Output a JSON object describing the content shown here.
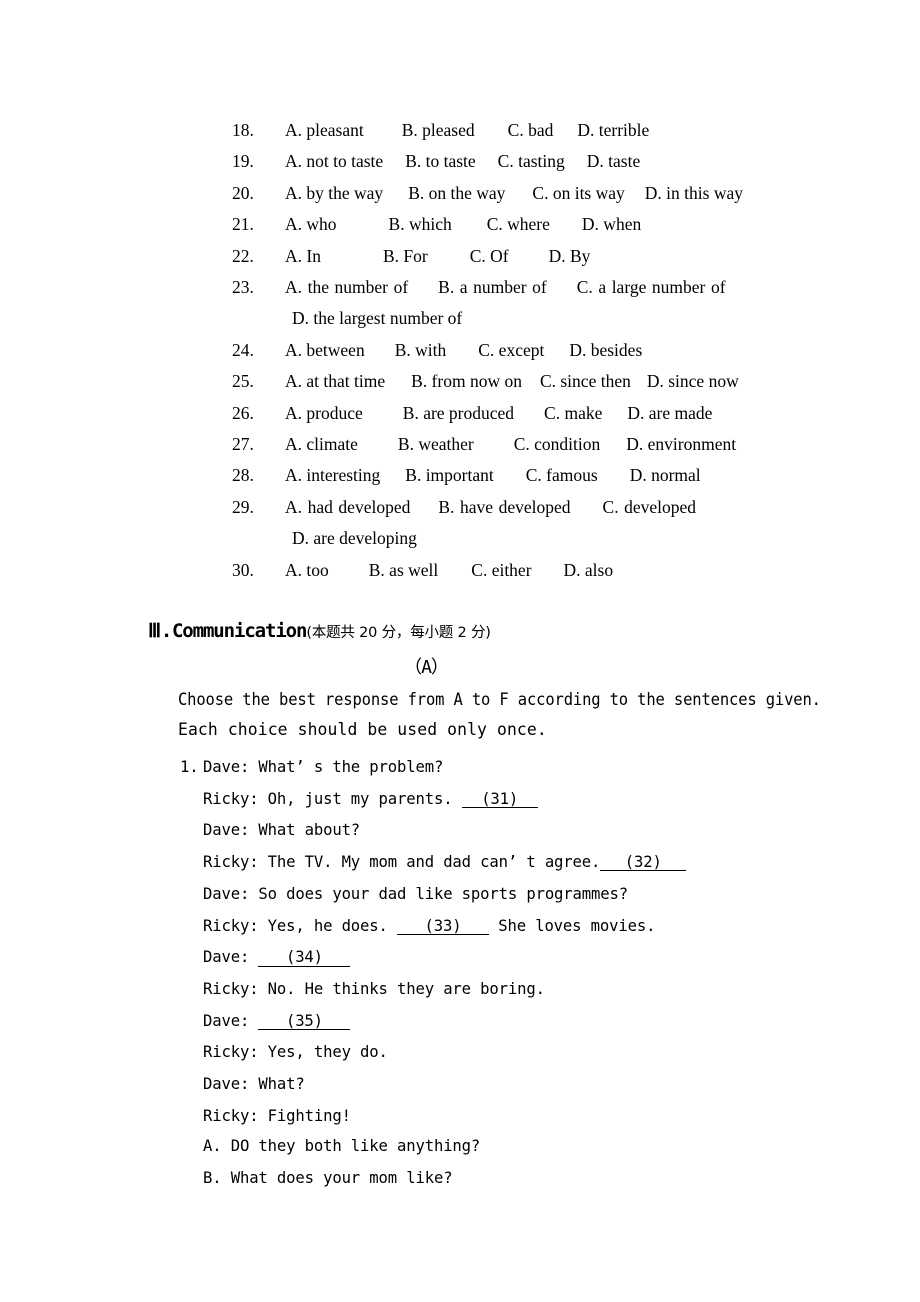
{
  "multiple_choice": {
    "items": [
      {
        "number": "18.",
        "options": [
          "A. pleasant",
          "B. pleased",
          "C. bad",
          "D. terrible"
        ],
        "gaps": [
          38,
          33,
          24
        ],
        "continuation": null
      },
      {
        "number": "19.",
        "options": [
          "A. not to taste",
          "B. to taste",
          "C. tasting",
          "D. taste"
        ],
        "gaps": [
          22,
          22,
          22
        ],
        "continuation": null
      },
      {
        "number": "20.",
        "options": [
          "A. by the way",
          "B. on the way",
          "C. on its way",
          "D. in this way"
        ],
        "gaps": [
          25,
          27,
          20
        ],
        "continuation": null
      },
      {
        "number": "21.",
        "options": [
          "A. who",
          "B. which",
          "C. where",
          "D. when"
        ],
        "gaps": [
          52,
          35,
          32
        ],
        "continuation": null
      },
      {
        "number": "22.",
        "options": [
          "A. In",
          "B. For",
          "C. Of",
          "D. By"
        ],
        "gaps": [
          62,
          42,
          40
        ],
        "continuation": null
      },
      {
        "number": "23.",
        "options": [
          "A. the number of",
          "B. a number of",
          "C. a large number of"
        ],
        "gaps": [
          30,
          30
        ],
        "continuation": "D. the largest number of"
      },
      {
        "number": "24.",
        "options": [
          "A. between",
          "B. with",
          "C. except",
          "D. besides"
        ],
        "gaps": [
          30,
          32,
          25
        ],
        "continuation": null
      },
      {
        "number": "25.",
        "options": [
          "A. at that time",
          "B. from now on",
          "C. since then",
          "D. since now"
        ],
        "gaps": [
          26,
          18,
          16
        ],
        "continuation": null
      },
      {
        "number": "26.",
        "options": [
          "A. produce",
          "B. are produced",
          "C. make",
          "D. are made"
        ],
        "gaps": [
          40,
          30,
          25
        ],
        "continuation": null
      },
      {
        "number": "27.",
        "options": [
          "A. climate",
          "B. weather",
          "C. condition",
          "D. environment"
        ],
        "gaps": [
          40,
          40,
          26
        ],
        "continuation": null
      },
      {
        "number": "28.",
        "options": [
          "A. interesting",
          "B. important",
          "C. famous",
          "D. normal"
        ],
        "gaps": [
          25,
          32,
          32
        ],
        "continuation": null
      },
      {
        "number": "29.",
        "options": [
          "A. had developed",
          "B. have developed",
          "C. developed"
        ],
        "gaps": [
          28,
          32
        ],
        "continuation": "D. are developing"
      },
      {
        "number": "30.",
        "options": [
          "A. too",
          "B. as well",
          "C. either",
          "D. also"
        ],
        "gaps": [
          40,
          33,
          32
        ],
        "continuation": null
      }
    ]
  },
  "section": {
    "roman": "Ⅲ",
    "dot": ".",
    "title": "Communication",
    "subtitle": "(本题共 20 分，每小题 2 分)",
    "part_label": "（A）",
    "instruction_line_1": "Choose the best response from A to F according to the sentences given.",
    "instruction_line_2": "Each choice should be used only once."
  },
  "dialogue": {
    "item_number": "1.",
    "lines": [
      {
        "marker": "1.",
        "speaker": "Dave: What’ s the problem?",
        "blank": null,
        "tail": null
      },
      {
        "marker": "",
        "speaker": "Ricky: Oh, just my parents. ",
        "blank": "(31)",
        "blank_width": "w1",
        "tail": null
      },
      {
        "marker": "",
        "speaker": "Dave: What about?",
        "blank": null,
        "tail": null
      },
      {
        "marker": "",
        "speaker": "Ricky: The TV. My mom and dad can’ t agree.",
        "blank": "(32)",
        "blank_width": "w2",
        "tail": null
      },
      {
        "marker": "",
        "speaker": "Dave: So does your dad like sports programmes?",
        "blank": null,
        "tail": null
      },
      {
        "marker": "",
        "speaker": "Ricky: Yes, he does. ",
        "blank": "(33)",
        "blank_width": "w3",
        "tail": " She loves movies."
      },
      {
        "marker": "",
        "speaker": "Dave: ",
        "blank": "(34)",
        "blank_width": "w3",
        "tail": null
      },
      {
        "marker": "",
        "speaker": "Ricky: No. He thinks they are boring.",
        "blank": null,
        "tail": null
      },
      {
        "marker": "",
        "speaker": "Dave: ",
        "blank": "(35)",
        "blank_width": "w3",
        "tail": null
      },
      {
        "marker": "",
        "speaker": "Ricky: Yes, they do.",
        "blank": null,
        "tail": null
      },
      {
        "marker": "",
        "speaker": "Dave: What?",
        "blank": null,
        "tail": null
      },
      {
        "marker": "",
        "speaker": "Ricky: Fighting!",
        "blank": null,
        "tail": null
      }
    ],
    "answer_choices": [
      "A. DO they both like anything?",
      "B. What does your mom like?"
    ]
  }
}
